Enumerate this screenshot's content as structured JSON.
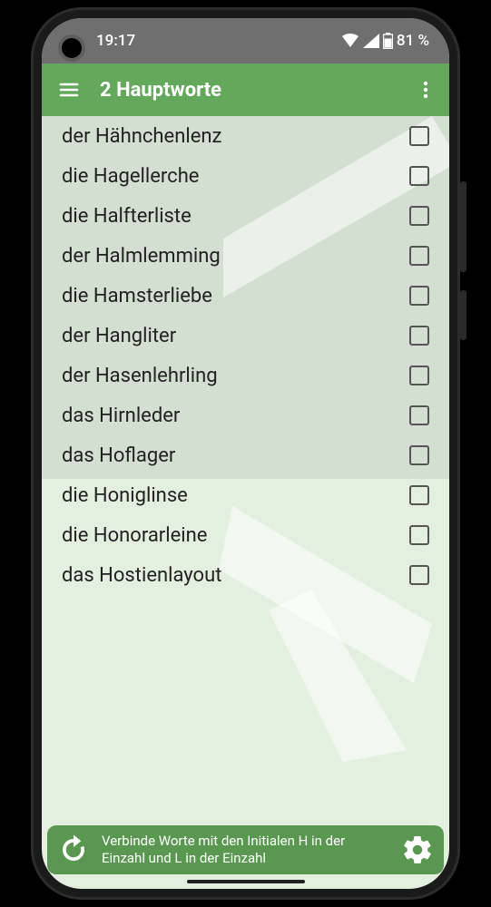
{
  "status": {
    "time": "19:17",
    "battery": "81 %"
  },
  "appbar": {
    "title": "2 Hauptworte"
  },
  "list": {
    "items": [
      {
        "label": "der Hähnchenlenz"
      },
      {
        "label": "die Hagellerche"
      },
      {
        "label": "die Halfterliste"
      },
      {
        "label": "der Halmlemming"
      },
      {
        "label": "die Hamsterliebe"
      },
      {
        "label": "der Hangliter"
      },
      {
        "label": "der Hasenlehrling"
      },
      {
        "label": "das Hirnleder"
      },
      {
        "label": "das Hoflager"
      },
      {
        "label": "die Honiglinse"
      },
      {
        "label": "die Honorarleine"
      },
      {
        "label": "das Hostienlayout"
      }
    ]
  },
  "bottom": {
    "hint": "Verbinde Worte mit den Initialen H in der Einzahl und L in der Einzahl"
  }
}
